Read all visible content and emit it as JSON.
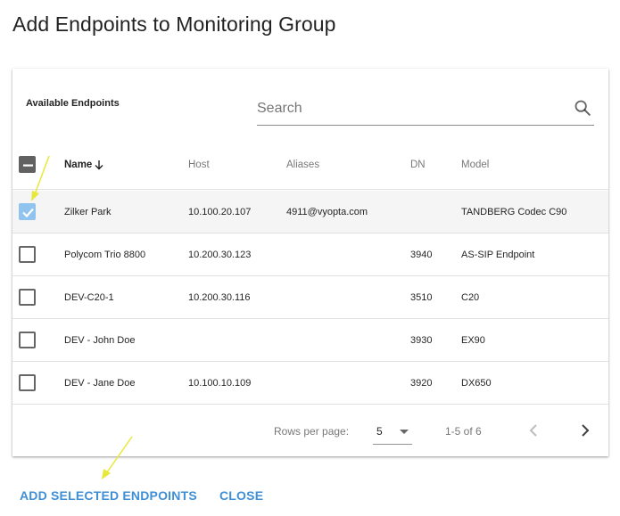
{
  "dialog": {
    "title": "Add Endpoints to Monitoring Group"
  },
  "card": {
    "title": "Available Endpoints",
    "search_placeholder": "Search"
  },
  "table": {
    "headers": {
      "name": "Name",
      "host": "Host",
      "aliases": "Aliases",
      "dn": "DN",
      "model": "Model"
    },
    "sort_indicator": "arrow-down-icon",
    "rows": [
      {
        "name": "Zilker Park",
        "host": "10.100.20.107",
        "aliases": "4911@vyopta.com",
        "dn": "",
        "model": "TANDBERG Codec C90",
        "checked": true
      },
      {
        "name": "Polycom Trio 8800",
        "host": "10.200.30.123",
        "aliases": "",
        "dn": "3940",
        "model": "AS-SIP Endpoint",
        "checked": false
      },
      {
        "name": "DEV-C20-1",
        "host": "10.200.30.116",
        "aliases": "",
        "dn": "3510",
        "model": "C20",
        "checked": false
      },
      {
        "name": "DEV - John Doe",
        "host": "",
        "aliases": "",
        "dn": "3930",
        "model": "EX90",
        "checked": false
      },
      {
        "name": "DEV - Jane Doe",
        "host": "10.100.10.109",
        "aliases": "",
        "dn": "3920",
        "model": "DX650",
        "checked": false
      }
    ]
  },
  "pagination": {
    "rows_per_page_label": "Rows per page:",
    "rows_per_page_value": "5",
    "range_text": "1-5 of 6"
  },
  "actions": {
    "add_label": "ADD SELECTED ENDPOINTS",
    "close_label": "CLOSE"
  },
  "colors": {
    "accent": "#3f8fd6",
    "checkbox_checked": "#90c4ee",
    "annotation_arrow": "#e8e83a"
  }
}
